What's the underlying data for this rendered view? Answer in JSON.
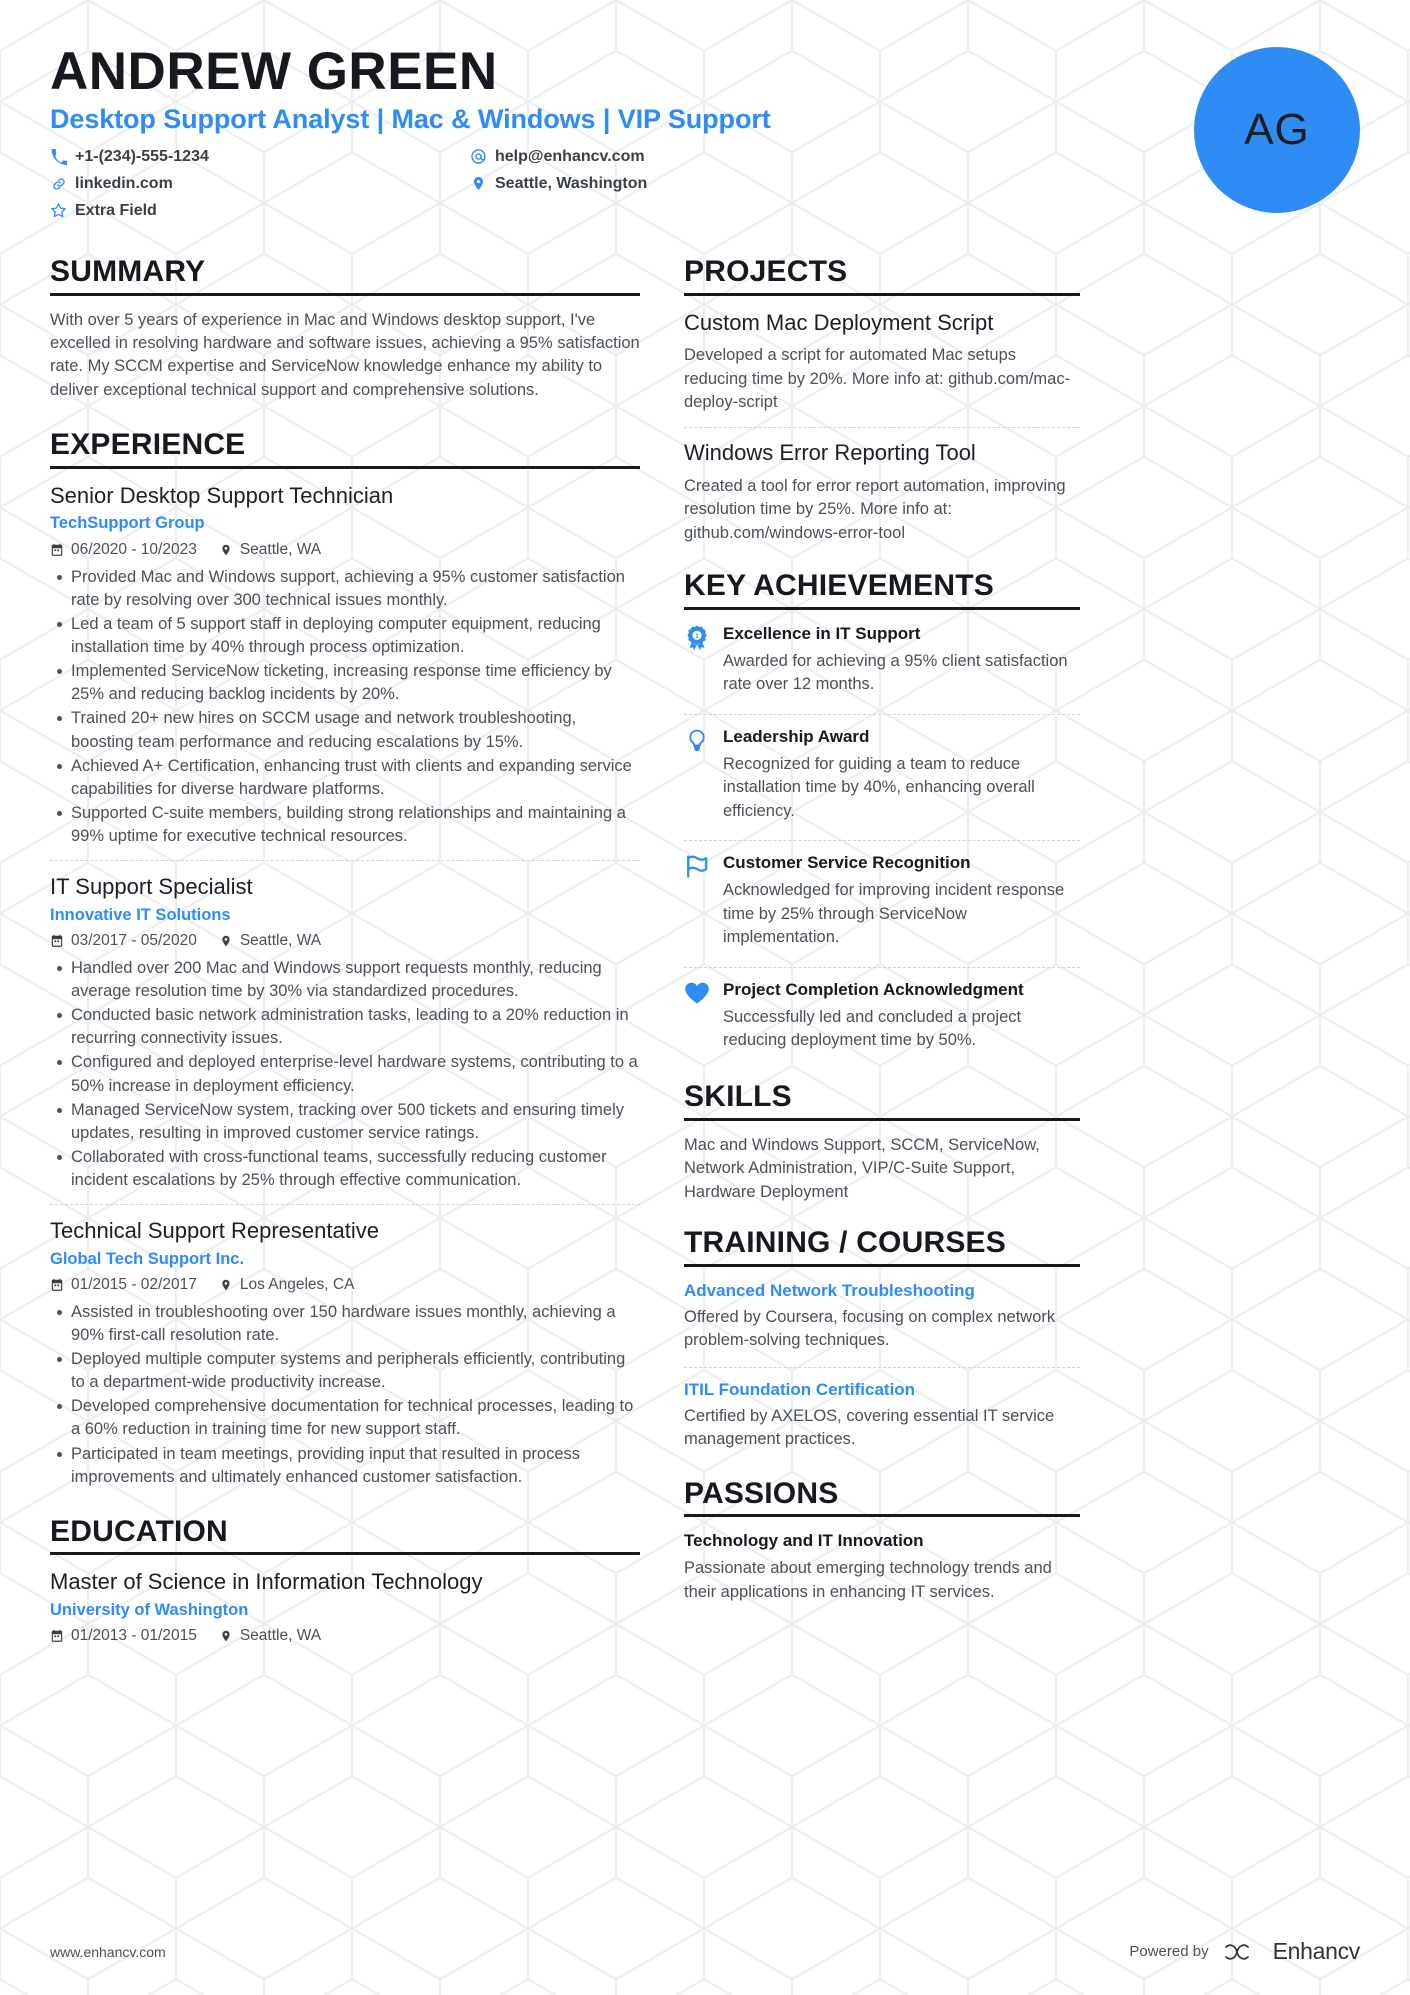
{
  "theme": {
    "accent": "#2f8cf5",
    "heading": "#16191f",
    "body": "#4a5159",
    "divider": "#cfd4d9"
  },
  "header": {
    "name": "ANDREW GREEN",
    "headline": "Desktop Support Analyst | Mac & Windows | VIP Support",
    "avatar_initials": "AG",
    "contacts": [
      {
        "icon": "phone-icon",
        "value": "+1-(234)-555-1234"
      },
      {
        "icon": "email-icon",
        "value": "help@enhancv.com"
      },
      {
        "icon": "link-icon",
        "value": "linkedin.com"
      },
      {
        "icon": "location-icon",
        "value": "Seattle, Washington"
      },
      {
        "icon": "star-icon",
        "value": "Extra Field"
      }
    ]
  },
  "left": {
    "summary": {
      "title": "SUMMARY",
      "text": "With over 5 years of experience in Mac and Windows desktop support, I've excelled in resolving hardware and software issues, achieving a 95% satisfaction rate. My SCCM expertise and ServiceNow knowledge enhance my ability to deliver exceptional technical support and comprehensive solutions."
    },
    "experience": {
      "title": "EXPERIENCE",
      "entries": [
        {
          "role": "Senior Desktop Support Technician",
          "company": "TechSupport Group",
          "dates": "06/2020 - 10/2023",
          "location": "Seattle, WA",
          "bullets": [
            "Provided Mac and Windows support, achieving a 95% customer satisfaction rate by resolving over 300 technical issues monthly.",
            "Led a team of 5 support staff in deploying computer equipment, reducing installation time by 40% through process optimization.",
            "Implemented ServiceNow ticketing, increasing response time efficiency by 25% and reducing backlog incidents by 20%.",
            "Trained 20+ new hires on SCCM usage and network troubleshooting, boosting team performance and reducing escalations by 15%.",
            "Achieved A+ Certification, enhancing trust with clients and expanding service capabilities for diverse hardware platforms.",
            "Supported C-suite members, building strong relationships and maintaining a 99% uptime for executive technical resources."
          ]
        },
        {
          "role": "IT Support Specialist",
          "company": "Innovative IT Solutions",
          "dates": "03/2017 - 05/2020",
          "location": "Seattle, WA",
          "bullets": [
            "Handled over 200 Mac and Windows support requests monthly, reducing average resolution time by 30% via standardized procedures.",
            "Conducted basic network administration tasks, leading to a 20% reduction in recurring connectivity issues.",
            "Configured and deployed enterprise-level hardware systems, contributing to a 50% increase in deployment efficiency.",
            "Managed ServiceNow system, tracking over 500 tickets and ensuring timely updates, resulting in improved customer service ratings.",
            "Collaborated with cross-functional teams, successfully reducing customer incident escalations by 25% through effective communication."
          ]
        },
        {
          "role": "Technical Support Representative",
          "company": "Global Tech Support Inc.",
          "dates": "01/2015 - 02/2017",
          "location": "Los Angeles, CA",
          "bullets": [
            "Assisted in troubleshooting over 150 hardware issues monthly, achieving a 90% first-call resolution rate.",
            "Deployed multiple computer systems and peripherals efficiently, contributing to a department-wide productivity increase.",
            "Developed comprehensive documentation for technical processes, leading to a 60% reduction in training time for new support staff.",
            "Participated in team meetings, providing input that resulted in process improvements and ultimately enhanced customer satisfaction."
          ]
        }
      ]
    },
    "education": {
      "title": "EDUCATION",
      "entries": [
        {
          "degree": "Master of Science in Information Technology",
          "school": "University of Washington",
          "dates": "01/2013 - 01/2015",
          "location": "Seattle, WA"
        }
      ]
    }
  },
  "right": {
    "projects": {
      "title": "PROJECTS",
      "entries": [
        {
          "name": "Custom Mac Deployment Script",
          "description": "Developed a script for automated Mac setups reducing time by 20%. More info at: github.com/mac-deploy-script"
        },
        {
          "name": "Windows Error Reporting Tool",
          "description": "Created a tool for error report automation, improving resolution time by 25%. More info at: github.com/windows-error-tool"
        }
      ]
    },
    "achievements": {
      "title": "KEY ACHIEVEMENTS",
      "entries": [
        {
          "icon": "award-ribbon-icon",
          "name": "Excellence in IT Support",
          "description": "Awarded for achieving a 95% client satisfaction rate over 12 months."
        },
        {
          "icon": "lightbulb-icon",
          "name": "Leadership Award",
          "description": "Recognized for guiding a team to reduce installation time by 40%, enhancing overall efficiency."
        },
        {
          "icon": "flag-icon",
          "name": "Customer Service Recognition",
          "description": "Acknowledged for improving incident response time by 25% through ServiceNow implementation."
        },
        {
          "icon": "heart-icon",
          "name": "Project Completion Acknowledgment",
          "description": "Successfully led and concluded a project reducing deployment time by 50%."
        }
      ]
    },
    "skills": {
      "title": "SKILLS",
      "text": "Mac and Windows Support, SCCM, ServiceNow, Network Administration, VIP/C-Suite Support, Hardware Deployment"
    },
    "training": {
      "title": "TRAINING / COURSES",
      "entries": [
        {
          "name": "Advanced Network Troubleshooting",
          "description": "Offered by Coursera, focusing on complex network problem-solving techniques."
        },
        {
          "name": "ITIL Foundation Certification",
          "description": "Certified by AXELOS, covering essential IT service management practices."
        }
      ]
    },
    "passions": {
      "title": "PASSIONS",
      "entries": [
        {
          "name": "Technology and IT Innovation",
          "description": "Passionate about emerging technology trends and their applications in enhancing IT services."
        }
      ]
    }
  },
  "footer": {
    "website": "www.enhancv.com",
    "powered_by": "Powered by",
    "brand": "Enhancv"
  }
}
